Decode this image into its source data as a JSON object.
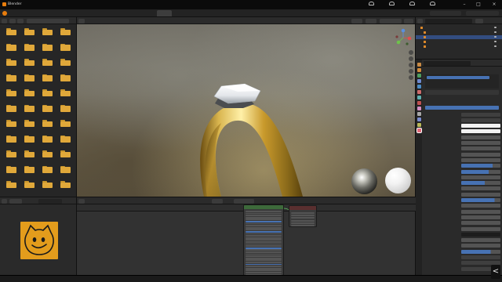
{
  "window": {
    "title": "Blender"
  },
  "colors": {
    "blender_orange": "#e87d0d",
    "selection_blue": "#4772b3",
    "folder_yellow": "#e0a83a",
    "cat_bg": "#e39c1c",
    "ring_gold": "#d4b14a",
    "gem": "#e9ebee"
  },
  "tray": [
    {
      "icon": "cat-icon",
      "label": ""
    },
    {
      "icon": "cat-icon",
      "label": ""
    },
    {
      "icon": "cat-icon",
      "label": ""
    },
    {
      "icon": "cat-icon",
      "label": ""
    }
  ],
  "menu": {
    "items": [
      "",
      "",
      "",
      "",
      "",
      ""
    ],
    "workspace_tabs": [
      {
        "label": "",
        "active": false
      },
      {
        "label": "",
        "active": false
      },
      {
        "label": "",
        "active": false
      },
      {
        "label": "",
        "active": false
      },
      {
        "label": "",
        "active": false
      },
      {
        "label": "",
        "active": false
      },
      {
        "label": "",
        "active": true
      },
      {
        "label": "",
        "active": false
      },
      {
        "label": "",
        "active": false
      },
      {
        "label": "",
        "active": false
      },
      {
        "label": "",
        "active": false
      }
    ]
  },
  "file_browser": {
    "path": "",
    "folders": [
      "",
      "",
      "",
      "",
      "",
      "",
      "",
      "",
      "",
      "",
      "",
      "",
      "",
      "",
      "",
      "",
      "",
      "",
      "",
      "",
      "",
      "",
      "",
      "",
      "",
      "",
      "",
      "",
      "",
      "",
      "",
      "",
      "",
      "",
      "",
      "",
      "",
      "",
      "",
      "",
      "",
      "",
      "",
      ""
    ]
  },
  "image_editor": {
    "image_name": "",
    "image_icon": "cat-face-drawing"
  },
  "viewport": {
    "header_items": [
      "",
      "",
      "",
      "",
      "",
      ""
    ],
    "info_lines": [
      "",
      "",
      ""
    ],
    "nav_icons": [
      "zoom-icon",
      "pan-icon",
      "camera-icon",
      "grid-icon",
      "light-icon"
    ]
  },
  "node_editor": {
    "header_items": [
      "",
      "",
      "",
      "",
      "",
      "",
      ""
    ],
    "object_name": "",
    "material_name": "",
    "slot": "",
    "nodes": [
      {
        "id": "bsdf",
        "title": "",
        "rows": 32
      },
      {
        "id": "output",
        "title": "",
        "rows": 6
      }
    ]
  },
  "outliner": {
    "rows": [
      {
        "label": "",
        "selected": false
      },
      {
        "label": "",
        "selected": false
      },
      {
        "label": "",
        "selected": true
      },
      {
        "label": "",
        "selected": false
      },
      {
        "label": "",
        "selected": false
      }
    ]
  },
  "properties": {
    "object": "",
    "material": "",
    "material_slot": "",
    "sections": [
      "",
      ""
    ],
    "rows": [
      {
        "label": "",
        "kind": "select"
      },
      {
        "label": "",
        "kind": "select"
      },
      {
        "label": "",
        "kind": "color-white"
      },
      {
        "label": "",
        "kind": "color-white"
      },
      {
        "label": "",
        "kind": "number"
      },
      {
        "label": "",
        "kind": "number"
      },
      {
        "label": "",
        "kind": "number"
      },
      {
        "label": "",
        "kind": "number"
      },
      {
        "label": "",
        "kind": "number"
      },
      {
        "label": "",
        "kind": "slider",
        "fill": 0.8
      },
      {
        "label": "",
        "kind": "slider",
        "fill": 0.7
      },
      {
        "label": "",
        "kind": "number"
      },
      {
        "label": "",
        "kind": "slider",
        "fill": 0.6
      },
      {
        "label": "",
        "kind": "number"
      },
      {
        "label": "",
        "kind": "number"
      },
      {
        "label": "",
        "kind": "slider",
        "fill": 0.85
      },
      {
        "label": "",
        "kind": "number"
      },
      {
        "label": "",
        "kind": "number"
      },
      {
        "label": "",
        "kind": "number"
      },
      {
        "label": "",
        "kind": "number"
      },
      {
        "label": "",
        "kind": "number"
      },
      {
        "label": "",
        "kind": "color-dark"
      },
      {
        "label": "",
        "kind": "number"
      },
      {
        "label": "",
        "kind": "number"
      },
      {
        "label": "",
        "kind": "slider",
        "fill": 0.75
      },
      {
        "label": "",
        "kind": "select"
      },
      {
        "label": "",
        "kind": "select"
      },
      {
        "label": "",
        "kind": "select"
      }
    ]
  },
  "taskbar": {
    "status_items": [
      "",
      "",
      "",
      "",
      "",
      ""
    ],
    "next_button": "<"
  }
}
